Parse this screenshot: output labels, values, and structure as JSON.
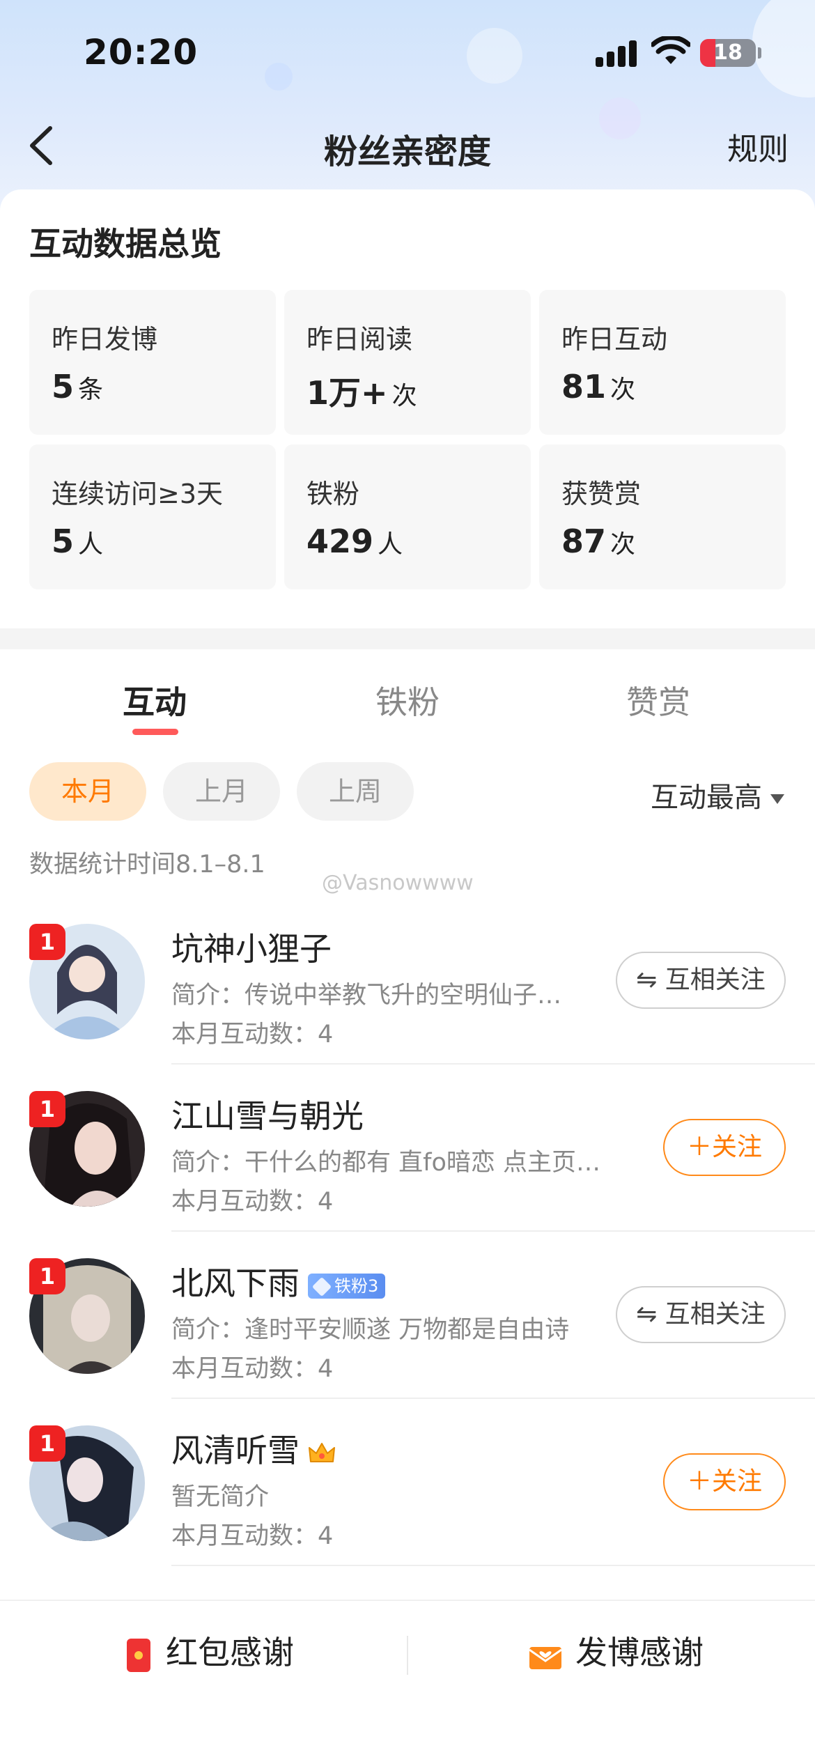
{
  "status_bar": {
    "time": "20:20",
    "battery": "18"
  },
  "nav": {
    "title": "粉丝亲密度",
    "rules_label": "规则"
  },
  "overview": {
    "title": "互动数据总览",
    "stats": [
      {
        "label": "昨日发博",
        "value": "5",
        "unit": "条"
      },
      {
        "label": "昨日阅读",
        "value": "1万+",
        "unit": "次"
      },
      {
        "label": "昨日互动",
        "value": "81",
        "unit": "次"
      },
      {
        "label": "连续访问≥3天",
        "value": "5",
        "unit": "人"
      },
      {
        "label": "铁粉",
        "value": "429",
        "unit": "人"
      },
      {
        "label": "获赞赏",
        "value": "87",
        "unit": "次"
      }
    ]
  },
  "tabs": [
    "互动",
    "铁粉",
    "赞赏"
  ],
  "filters": [
    "本月",
    "上月",
    "上周"
  ],
  "sort_label": "互动最高",
  "stat_time": "数据统计时间8.1–8.1",
  "watermark": "@Vasnowwww",
  "list": [
    {
      "rank": "1",
      "name": "坑神小狸子",
      "bio": "简介：传说中举教飞升的空明仙子…",
      "count": "本月互动数：4",
      "action": "⇋ 互相关注"
    },
    {
      "rank": "1",
      "name": "江山雪与朝光",
      "bio": "简介：干什么的都有 直fo暗恋 点主页…",
      "count": "本月互动数：4",
      "action": "＋关注"
    },
    {
      "rank": "1",
      "name": "北风下雨",
      "badge": "铁粉3",
      "bio": "简介：逢时平安顺遂 万物都是自由诗",
      "count": "本月互动数：4",
      "action": "⇋ 互相关注"
    },
    {
      "rank": "1",
      "name": "风清听雪",
      "bio": "暂无简介",
      "count": "本月互动数：4",
      "action": "＋关注"
    }
  ],
  "bottom": {
    "red_packet": "红包感谢",
    "post_thanks": "发博感谢"
  }
}
